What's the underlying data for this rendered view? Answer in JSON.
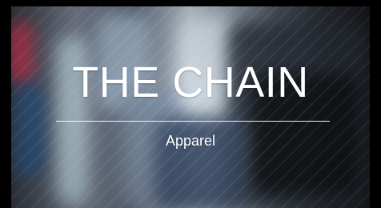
{
  "brand": {
    "name": "THE CHAIN",
    "tagline": "Apparel"
  }
}
